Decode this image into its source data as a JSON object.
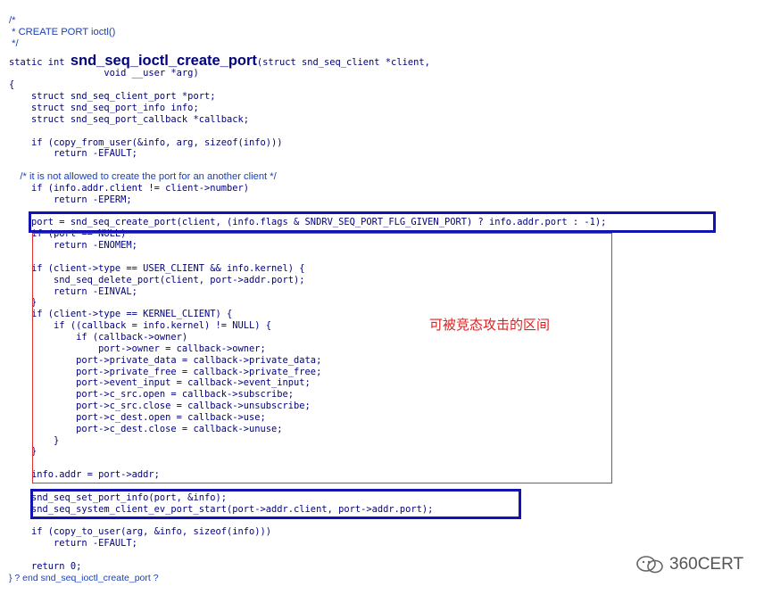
{
  "code_lines": [
    {
      "text": "/*",
      "cls": "comment"
    },
    {
      "text": " * CREATE PORT ioctl()",
      "cls": "comment"
    },
    {
      "text": " */",
      "cls": "comment"
    },
    {
      "text": "",
      "cls": "code"
    },
    {
      "text": "                 void __user *arg)",
      "cls": "code"
    },
    {
      "text": "{",
      "cls": "code"
    },
    {
      "text": "    struct snd_seq_client_port *port;",
      "cls": "code"
    },
    {
      "text": "    struct snd_seq_port_info info;",
      "cls": "code"
    },
    {
      "text": "    struct snd_seq_port_callback *callback;",
      "cls": "code"
    },
    {
      "text": "",
      "cls": "code"
    },
    {
      "text": "    if (copy_from_user(&info, arg, sizeof(info)))",
      "cls": "code"
    },
    {
      "text": "        return -EFAULT;",
      "cls": "code"
    },
    {
      "text": "",
      "cls": "code"
    },
    {
      "text": "    /* it is not allowed to create the port for an another client */",
      "cls": "comment"
    },
    {
      "text": "    if (info.addr.client != client->number)",
      "cls": "code"
    },
    {
      "text": "        return -EPERM;",
      "cls": "code"
    },
    {
      "text": "",
      "cls": "code"
    },
    {
      "text": "    port = snd_seq_create_port(client, (info.flags & SNDRV_SEQ_PORT_FLG_GIVEN_PORT) ? info.addr.port : -1);",
      "cls": "code"
    },
    {
      "text": "    if (port == NULL)",
      "cls": "code"
    },
    {
      "text": "        return -ENOMEM;",
      "cls": "code"
    },
    {
      "text": "",
      "cls": "code"
    },
    {
      "text": "    if (client->type == USER_CLIENT && info.kernel) {",
      "cls": "code"
    },
    {
      "text": "        snd_seq_delete_port(client, port->addr.port);",
      "cls": "code"
    },
    {
      "text": "        return -EINVAL;",
      "cls": "code"
    },
    {
      "text": "    }",
      "cls": "code"
    },
    {
      "text": "    if (client->type == KERNEL_CLIENT) {",
      "cls": "code"
    },
    {
      "text": "        if ((callback = info.kernel) != NULL) {",
      "cls": "code"
    },
    {
      "text": "            if (callback->owner)",
      "cls": "code"
    },
    {
      "text": "                port->owner = callback->owner;",
      "cls": "code"
    },
    {
      "text": "            port->private_data = callback->private_data;",
      "cls": "code"
    },
    {
      "text": "            port->private_free = callback->private_free;",
      "cls": "code"
    },
    {
      "text": "            port->event_input = callback->event_input;",
      "cls": "code"
    },
    {
      "text": "            port->c_src.open = callback->subscribe;",
      "cls": "code"
    },
    {
      "text": "            port->c_src.close = callback->unsubscribe;",
      "cls": "code"
    },
    {
      "text": "            port->c_dest.open = callback->use;",
      "cls": "code"
    },
    {
      "text": "            port->c_dest.close = callback->unuse;",
      "cls": "code"
    },
    {
      "text": "        }",
      "cls": "code"
    },
    {
      "text": "    }",
      "cls": "code"
    },
    {
      "text": "",
      "cls": "code"
    },
    {
      "text": "    info.addr = port->addr;",
      "cls": "code"
    },
    {
      "text": "",
      "cls": "code"
    },
    {
      "text": "    snd_seq_set_port_info(port, &info);",
      "cls": "code"
    },
    {
      "text": "    snd_seq_system_client_ev_port_start(port->addr.client, port->addr.port);",
      "cls": "code"
    },
    {
      "text": "",
      "cls": "code"
    },
    {
      "text": "    if (copy_to_user(arg, &info, sizeof(info)))",
      "cls": "code"
    },
    {
      "text": "        return -EFAULT;",
      "cls": "code"
    },
    {
      "text": "",
      "cls": "code"
    },
    {
      "text": "    return 0;",
      "cls": "code"
    },
    {
      "text": "} ? end snd_seq_ioctl_create_port ?",
      "cls": "endc"
    }
  ],
  "signature": {
    "prefix": "static int ",
    "function_name": "snd_seq_ioctl_create_port",
    "params": "(struct snd_seq_client *client,"
  },
  "annotation": "可被竞态攻击的区间",
  "watermark": "360CERT",
  "colors": {
    "keyword": "#00007f",
    "comment": "#1a3fb8",
    "highlight_box": "#1313b3",
    "race_box": "#e03030",
    "annotation": "#e01e1e"
  }
}
